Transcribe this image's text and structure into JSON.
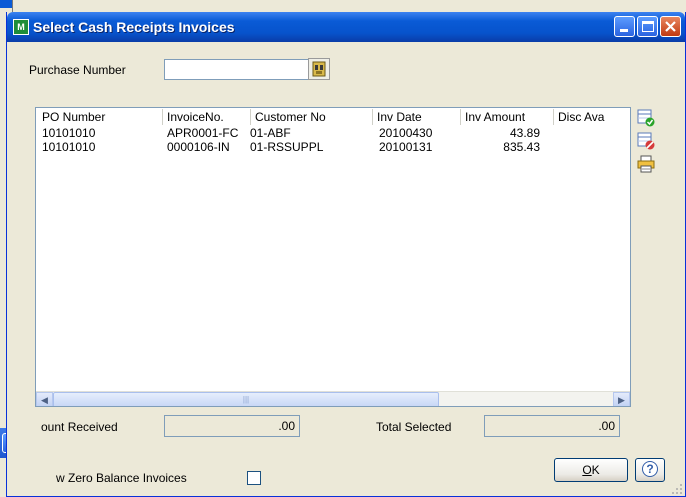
{
  "dialog": {
    "title": "Select Cash Receipts Invoices"
  },
  "form": {
    "purchase_number_label": "Purchase Number",
    "purchase_number_value": ""
  },
  "table": {
    "columns": [
      "PO Number",
      "InvoiceNo.",
      "Customer No",
      "Inv Date",
      "Inv Amount",
      "Disc Ava"
    ],
    "rows": [
      [
        "10101010",
        "APR0001-FC",
        "01-ABF",
        "20100430",
        "43.89",
        ""
      ],
      [
        "10101010",
        "0000106-IN",
        "01-RSSUPPL",
        "20100131",
        "835.43",
        ""
      ]
    ]
  },
  "totals": {
    "amount_received_label": "ount Received",
    "amount_received_value": ".00",
    "total_selected_label": "Total Selected",
    "total_selected_value": ".00"
  },
  "options": {
    "zero_balance_label": "w Zero Balance Invoices",
    "zero_balance_checked": false
  },
  "buttons": {
    "ok_mnemonic": "O",
    "ok_rest": "K",
    "help_glyph": "?"
  },
  "icons": {
    "select_all": "select-all-icon",
    "clear_all": "clear-selection-icon",
    "print": "print-icon",
    "lookup": "lookup-icon"
  },
  "colors": {
    "titlebar": "#0A5BD6",
    "window_bg": "#ECE9D8",
    "close_button": "#D44A1E"
  }
}
